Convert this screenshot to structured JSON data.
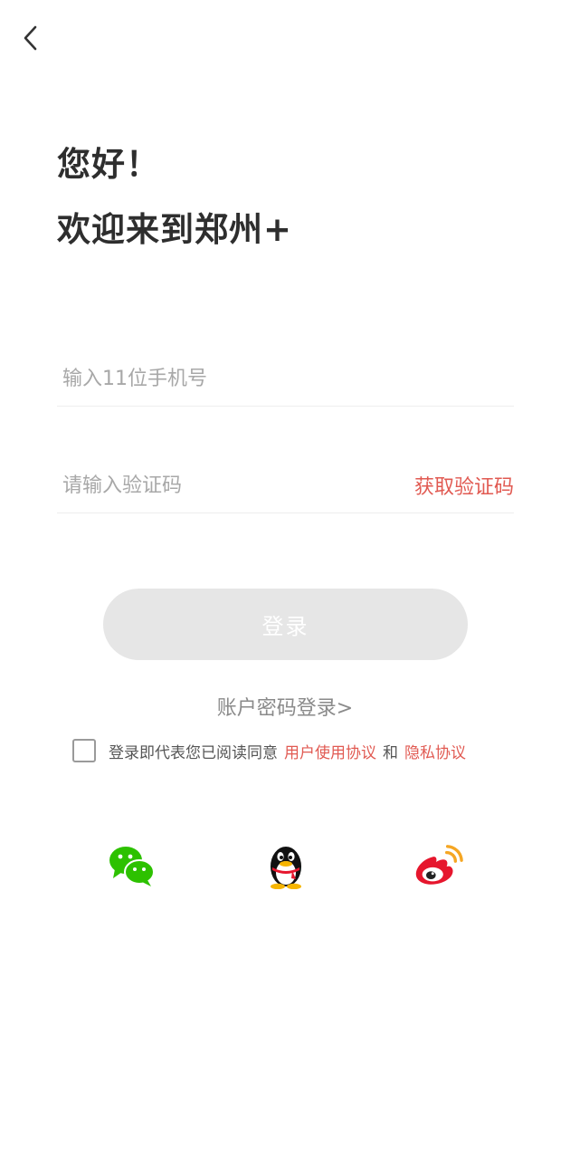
{
  "header": {
    "back_icon": "chevron-left-icon"
  },
  "hero": {
    "greeting": "您好！",
    "welcome": "欢迎来到郑州+"
  },
  "form": {
    "phone_placeholder": "输入11位手机号",
    "code_placeholder": "请输入验证码",
    "get_code_label": "获取验证码",
    "login_label": "登录",
    "password_login_label": "账户密码登录>"
  },
  "agreement": {
    "prefix": "登录即代表您已阅读同意",
    "user_agreement": "用户使用协议",
    "and": "和",
    "privacy": "隐私协议"
  },
  "social": {
    "icons": [
      "wechat-icon",
      "qq-icon",
      "weibo-icon"
    ]
  },
  "colors": {
    "accent": "#e15a52",
    "button_disabled": "#e6e6e6",
    "wechat": "#2dc100",
    "weibo": "#e6162d",
    "weibo_orange": "#f5a623"
  }
}
